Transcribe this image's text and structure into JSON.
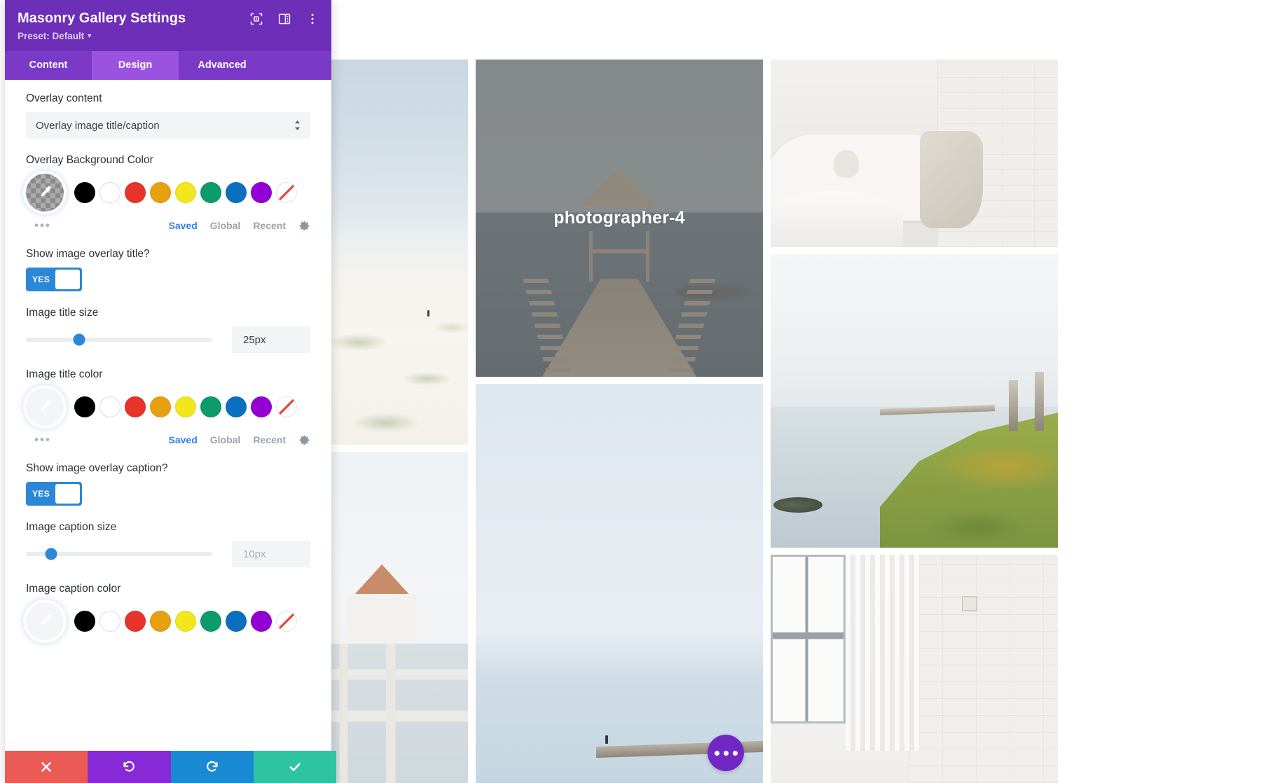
{
  "panel": {
    "title": "Masonry Gallery Settings",
    "preset_label": "Preset: Default",
    "header_icons": [
      {
        "name": "focus-target-icon"
      },
      {
        "name": "layout-columns-icon"
      },
      {
        "name": "more-vertical-icon"
      }
    ],
    "tabs": [
      {
        "id": "content",
        "label": "Content",
        "active": false
      },
      {
        "id": "design",
        "label": "Design",
        "active": true
      },
      {
        "id": "advanced",
        "label": "Advanced",
        "active": false
      }
    ],
    "fields": {
      "overlay_content": {
        "label": "Overlay content",
        "selected": "Overlay image title/caption",
        "options": [
          "Overlay image title/caption"
        ]
      },
      "overlay_background_color": {
        "label": "Overlay Background Color",
        "active_swatch": "transparent-checker",
        "swatches": [
          "#000000",
          "#ffffff",
          "#e8332a",
          "#e8a013",
          "#f2e71c",
          "#0d9b6c",
          "#0b6fc0",
          "#9400d3",
          "none"
        ],
        "links": {
          "saved": "Saved",
          "global": "Global",
          "recent": "Recent",
          "settings_icon": "gear-icon"
        },
        "more_dots": "•••"
      },
      "show_image_overlay_title": {
        "label": "Show image overlay title?",
        "value": "YES"
      },
      "image_title_size": {
        "label": "Image title size",
        "value": "25px",
        "slider_percent": 27
      },
      "image_title_color": {
        "label": "Image title color",
        "active_swatch": "#ffffff",
        "swatches": [
          "#000000",
          "#ffffff",
          "#e8332a",
          "#e8a013",
          "#f2e71c",
          "#0d9b6c",
          "#0b6fc0",
          "#9400d3",
          "none"
        ],
        "links": {
          "saved": "Saved",
          "global": "Global",
          "recent": "Recent",
          "settings_icon": "gear-icon"
        },
        "more_dots": "•••"
      },
      "show_image_overlay_caption": {
        "label": "Show image overlay caption?",
        "value": "YES"
      },
      "image_caption_size": {
        "label": "Image caption size",
        "value": "10px",
        "slider_percent": 13
      },
      "image_caption_color": {
        "label": "Image caption color",
        "active_swatch": "#ffffff",
        "swatches": [
          "#000000",
          "#ffffff",
          "#e8332a",
          "#e8a013",
          "#f2e71c",
          "#0d9b6c",
          "#0b6fc0",
          "#9400d3",
          "none"
        ]
      }
    },
    "actions": [
      {
        "id": "cancel",
        "icon": "close-icon",
        "color": "#ec5a55"
      },
      {
        "id": "undo",
        "icon": "undo-icon",
        "color": "#8729d6"
      },
      {
        "id": "redo",
        "icon": "redo-icon",
        "color": "#1b8ad4"
      },
      {
        "id": "save",
        "icon": "checkmark-icon",
        "color": "#2ec4a1"
      }
    ]
  },
  "gallery": {
    "overlay_title": "photographer-4",
    "fab": {
      "name": "more-options-button",
      "glyph": "•••"
    },
    "tiles": [
      {
        "id": "sand",
        "alt": "white sand dunes with distant figure"
      },
      {
        "id": "house",
        "alt": "white fence with red roofed house"
      },
      {
        "id": "pier",
        "alt": "wooden pier with thatched gazebo",
        "overlay": true
      },
      {
        "id": "sea",
        "alt": "calm sea with pier and lone figure"
      },
      {
        "id": "sofa",
        "alt": "white curved sofa and marble table"
      },
      {
        "id": "cliff",
        "alt": "wooden bench on coastal cliff"
      },
      {
        "id": "window",
        "alt": "white brick wall with window and curtain"
      }
    ]
  }
}
